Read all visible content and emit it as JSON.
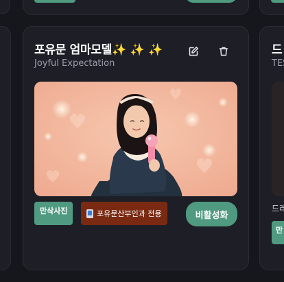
{
  "card": {
    "title": "포유문 엄마모델✨ ✨ ✨",
    "subtitle": "Joyful Expectation",
    "tag_primary": "만삭사진",
    "tag_secondary": "포유문산부인과 전용",
    "deactivate_label": "비활성화",
    "edit_icon": "edit-icon",
    "delete_icon": "trash-icon"
  },
  "right_card": {
    "title": "드",
    "subtitle": "TES",
    "caption": "드레",
    "tag": "만"
  },
  "colors": {
    "card_bg": "#1e1f26",
    "accent_green": "#4f9a80",
    "tag_red": "#7a2a12",
    "subtitle_gray": "#9c9eaa"
  }
}
